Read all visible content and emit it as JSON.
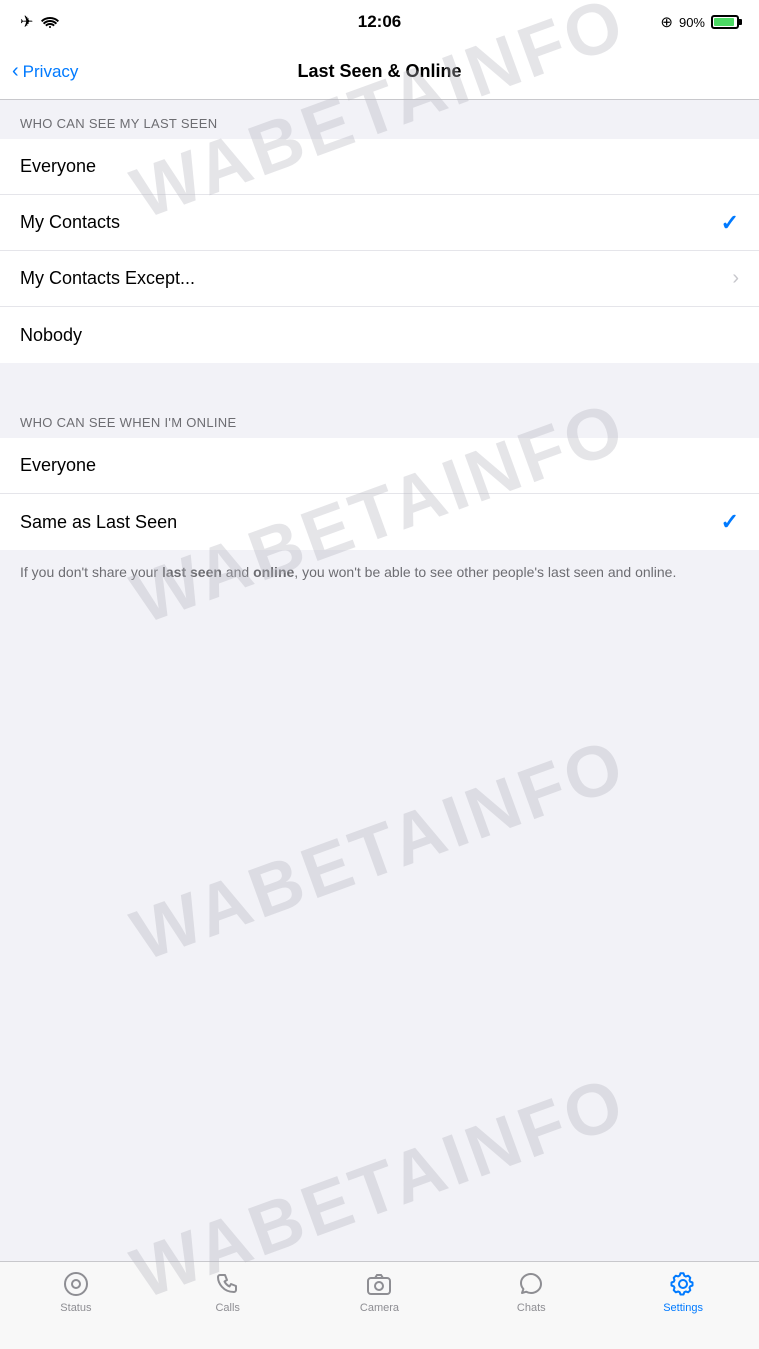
{
  "statusBar": {
    "time": "12:06",
    "batteryPercent": "90%",
    "icons": {
      "airplane": "✈",
      "wifi": "wifi",
      "locationDot": "⊕"
    }
  },
  "navBar": {
    "backLabel": "Privacy",
    "title": "Last Seen & Online"
  },
  "lastSeenSection": {
    "header": "WHO CAN SEE MY LAST SEEN",
    "options": [
      {
        "label": "Everyone",
        "selected": false,
        "hasChevron": false
      },
      {
        "label": "My Contacts",
        "selected": true,
        "hasChevron": false
      },
      {
        "label": "My Contacts Except...",
        "selected": false,
        "hasChevron": true
      },
      {
        "label": "Nobody",
        "selected": false,
        "hasChevron": false
      }
    ]
  },
  "onlineSection": {
    "header": "WHO CAN SEE WHEN I'M ONLINE",
    "options": [
      {
        "label": "Everyone",
        "selected": false,
        "hasChevron": false
      },
      {
        "label": "Same as Last Seen",
        "selected": true,
        "hasChevron": false
      }
    ]
  },
  "footerNote": {
    "prefix": "If you don't share your ",
    "bold1": "last seen",
    "middle": " and ",
    "bold2": "online",
    "suffix": ", you won't be able to see other people's last seen and online."
  },
  "tabBar": {
    "items": [
      {
        "label": "Status",
        "icon": "status",
        "active": false
      },
      {
        "label": "Calls",
        "icon": "calls",
        "active": false
      },
      {
        "label": "Camera",
        "icon": "camera",
        "active": false
      },
      {
        "label": "Chats",
        "icon": "chats",
        "active": false
      },
      {
        "label": "Settings",
        "icon": "settings",
        "active": true
      }
    ]
  },
  "watermark": "WABETAINFO"
}
